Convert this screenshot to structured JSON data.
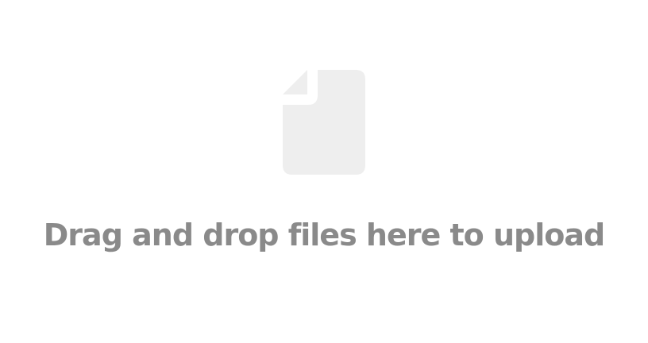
{
  "dropzone": {
    "icon": "file-icon",
    "message": "Drag and drop files here to upload"
  },
  "colors": {
    "icon_fill": "#eeeeee",
    "text": "#8a8a8a",
    "background": "#ffffff"
  }
}
